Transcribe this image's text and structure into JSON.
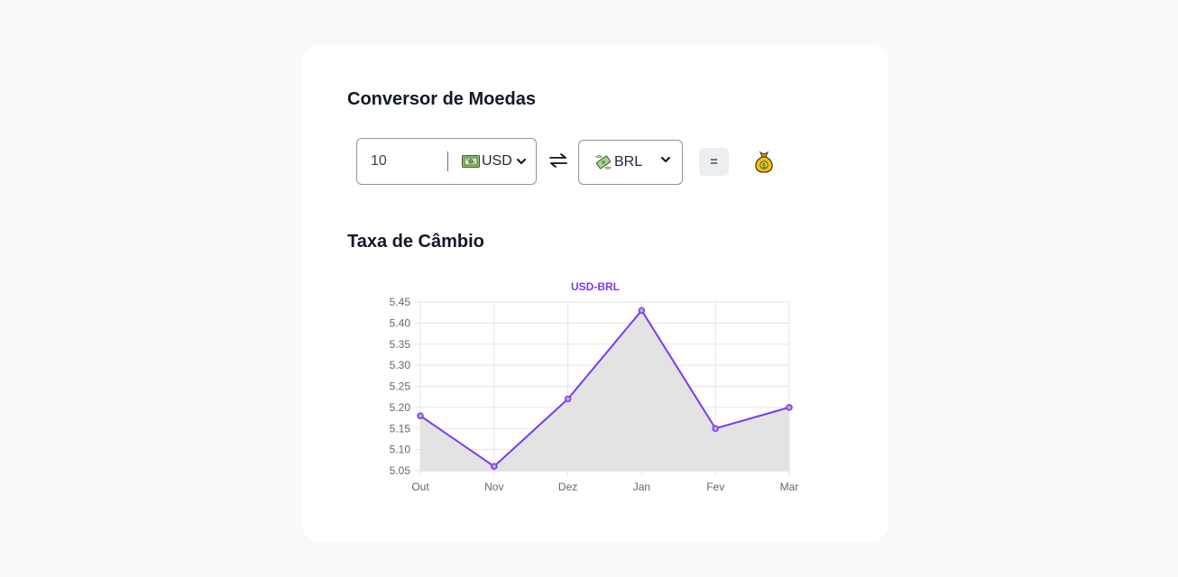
{
  "converter": {
    "title": "Conversor de Moedas",
    "amount": "10",
    "from_currency": "USD",
    "from_icon": "banknote-icon",
    "swap_icon": "swap-arrows-icon",
    "to_currency": "BRL",
    "to_icon": "money-wings-icon",
    "equals_label": "=",
    "result_icon": "money-bag-icon"
  },
  "rate_section": {
    "title": "Taxa de Câmbio"
  },
  "chart_data": {
    "type": "line",
    "title": "USD-BRL",
    "categories": [
      "Out",
      "Nov",
      "Dez",
      "Jan",
      "Fev",
      "Mar"
    ],
    "series": [
      {
        "name": "USD-BRL",
        "values": [
          5.18,
          5.06,
          5.22,
          5.43,
          5.15,
          5.2
        ]
      }
    ],
    "ylim": [
      5.05,
      5.45
    ],
    "yticks": [
      "5.45",
      "5.40",
      "5.35",
      "5.30",
      "5.25",
      "5.20",
      "5.15",
      "5.10",
      "5.05"
    ],
    "xlabel": "",
    "ylabel": "",
    "grid": true,
    "fill": true,
    "colors": {
      "line": "#7c3aed",
      "fill": "#e3e3e3",
      "grid": "#e5e5e5",
      "title": "#7c3aed"
    }
  }
}
